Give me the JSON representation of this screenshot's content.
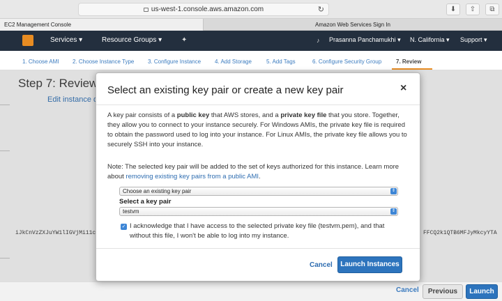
{
  "browser": {
    "url": "us-west-1.console.aws.amazon.com",
    "reload_icon": "↻"
  },
  "tabs": [
    {
      "label": "EC2 Management Console"
    },
    {
      "label": "Amazon Web Services Sign In"
    }
  ],
  "nav": {
    "services": "Services",
    "resource_groups": "Resource Groups",
    "user": "Prasanna Panchamukhi",
    "region": "N. California",
    "support": "Support",
    "caret": "▾",
    "pin_icon": "✦"
  },
  "steps": [
    {
      "label": "1. Choose AMI"
    },
    {
      "label": "2. Choose Instance Type"
    },
    {
      "label": "3. Configure Instance"
    },
    {
      "label": "4. Add Storage"
    },
    {
      "label": "5. Add Tags"
    },
    {
      "label": "6. Configure Security Group"
    },
    {
      "label": "7. Review"
    }
  ],
  "page": {
    "title": "Step 7: Review",
    "edit_link": "Edit instance d",
    "fragment_left": "iJkCnVzZXJuYW1lIGVjMi11c",
    "fragment_right": "FFCQ2k1QTB6MFJyMkcyYTA"
  },
  "bottom": {
    "cancel": "Cancel",
    "previous": "Previous",
    "launch": "Launch"
  },
  "modal": {
    "title": "Select an existing key pair or create a new key pair",
    "close": "×",
    "p1_a": "A key pair consists of a ",
    "p1_b": "public key",
    "p1_c": " that AWS stores, and a ",
    "p1_d": "private key file",
    "p1_e": " that you store. Together, they allow you to connect to your instance securely. For Windows AMIs, the private key file is required to obtain the password used to log into your instance. For Linux AMIs, the private key file allows you to securely SSH into your instance.",
    "p2_a": "Note: The selected key pair will be added to the set of keys authorized for this instance. Learn more about ",
    "p2_link": "removing existing key pairs from a public AMI",
    "p2_c": ".",
    "select_mode": "Choose an existing key pair",
    "select_label": "Select a key pair",
    "select_value": "testvm",
    "select_arrow": "⇕",
    "ack_checked": true,
    "ack_check": "✓",
    "ack_text": "I acknowledge that I have access to the selected private key file (testvm.pem), and that without this file, I won't be able to log into my instance.",
    "cancel": "Cancel",
    "launch": "Launch Instances"
  },
  "colors": {
    "nav_bg": "#232f3e",
    "accent": "#e88c22",
    "primary_button": "#2d74bd",
    "link": "#2d6cb0"
  }
}
